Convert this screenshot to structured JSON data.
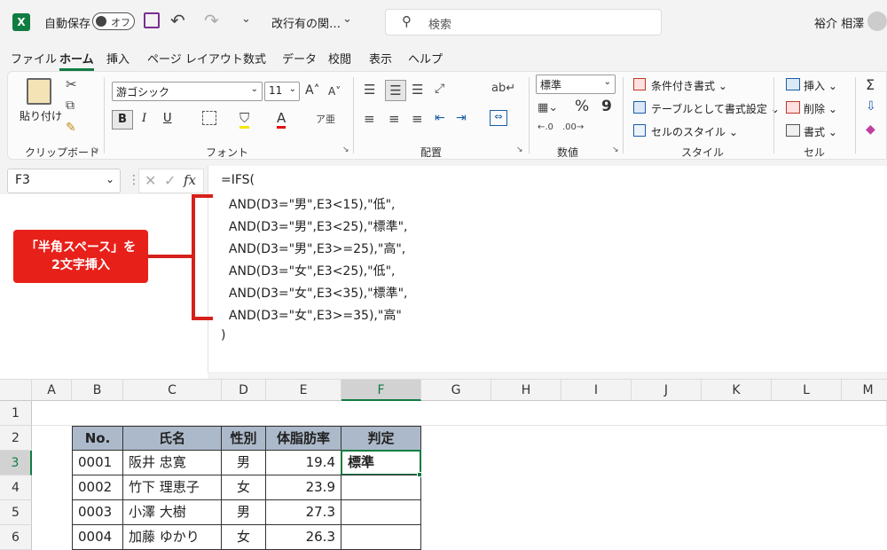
{
  "titlebar": {
    "logo": "X",
    "autosave_label": "自動保存",
    "toggle_state": "オフ",
    "doc_title": "改行有の関…",
    "search_placeholder": "検索",
    "user_name": "裕介 相澤"
  },
  "menu": [
    "ファイル",
    "ホーム",
    "挿入",
    "ページ レイアウト",
    "数式",
    "データ",
    "校閲",
    "表示",
    "ヘルプ"
  ],
  "ribbon": {
    "clipboard": {
      "paste": "貼り付け",
      "label": "クリップボード"
    },
    "font": {
      "name": "游ゴシック",
      "size": "11",
      "label": "フォント"
    },
    "alignment": {
      "label": "配置"
    },
    "number": {
      "format": "標準",
      "percent": "%",
      "comma": "9",
      "label": "数値"
    },
    "styles": {
      "cond": "条件付き書式",
      "table": "テーブルとして書式設定",
      "cell": "セルのスタイル",
      "label": "スタイル"
    },
    "cells": {
      "insert": "挿入",
      "delete": "削除",
      "format": "書式",
      "label": "セル"
    }
  },
  "formula_bar": {
    "namebox": "F3",
    "fx": "fx",
    "lines": [
      "=IFS(",
      "  AND(D3=\"男\",E3<15),\"低\",",
      "  AND(D3=\"男\",E3<25),\"標準\",",
      "  AND(D3=\"男\",E3>=25),\"高\",",
      "  AND(D3=\"女\",E3<25),\"低\",",
      "  AND(D3=\"女\",E3<35),\"標準\",",
      "  AND(D3=\"女\",E3>=35),\"高\"",
      ")"
    ]
  },
  "annotation": {
    "line1": "「半角スペース」を",
    "line2": "2文字挿入"
  },
  "sheet": {
    "columns": [
      "A",
      "B",
      "C",
      "D",
      "E",
      "F",
      "G",
      "H",
      "I",
      "J",
      "K",
      "L",
      "M"
    ],
    "rows": [
      "1",
      "2",
      "3",
      "4",
      "5",
      "6"
    ],
    "headers": [
      "No.",
      "氏名",
      "性別",
      "体脂肪率",
      "判定"
    ],
    "data": [
      [
        "0001",
        "阪井 忠寛",
        "男",
        "19.4",
        "標準"
      ],
      [
        "0002",
        "竹下 理恵子",
        "女",
        "23.9",
        ""
      ],
      [
        "0003",
        "小澤 大樹",
        "男",
        "27.3",
        ""
      ],
      [
        "0004",
        "加藤 ゆかり",
        "女",
        "26.3",
        ""
      ]
    ]
  },
  "colors": {
    "excel_green": "#107c41",
    "header_fill": "#acb9ca",
    "annotation_red": "#e8201a"
  }
}
